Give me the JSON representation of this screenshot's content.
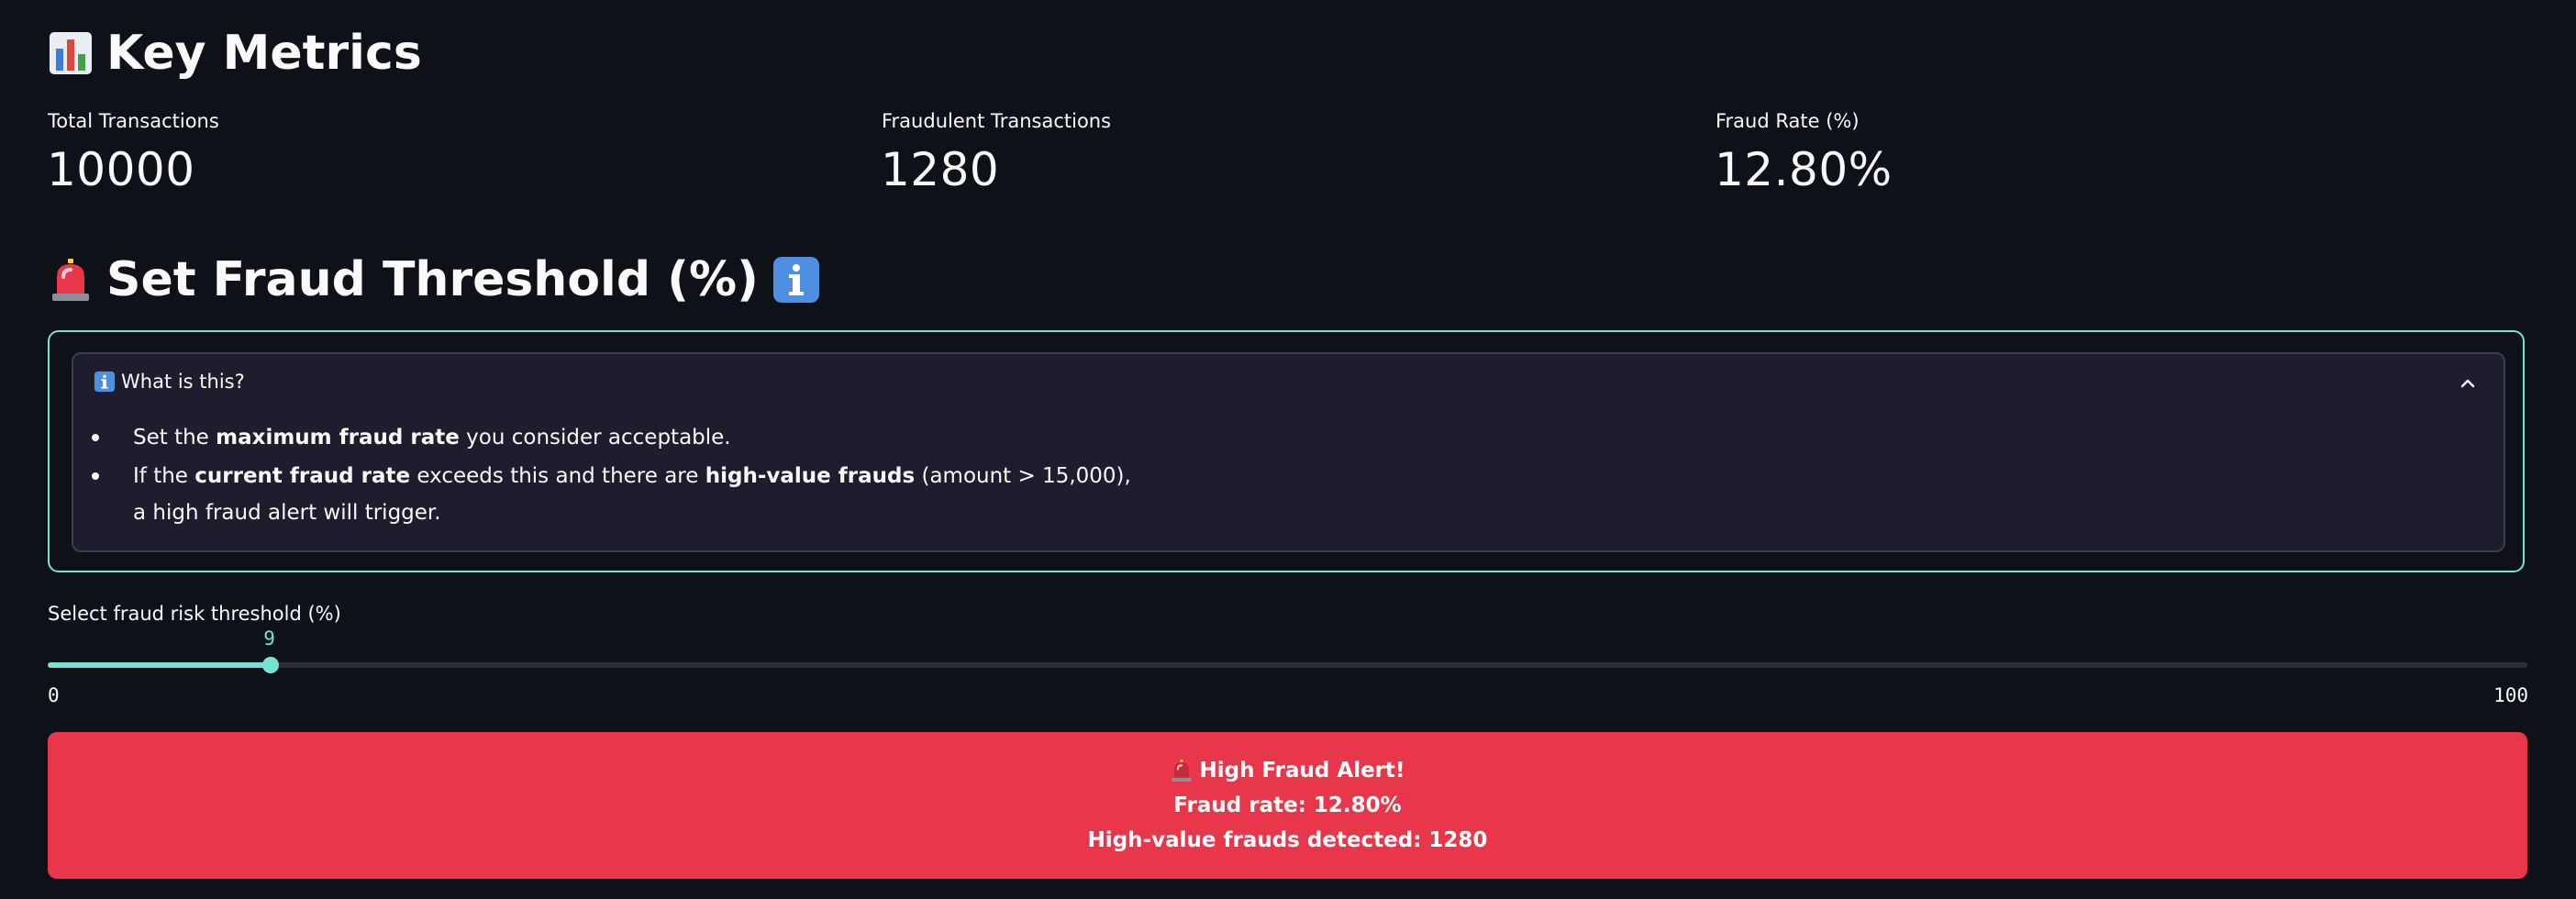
{
  "colors": {
    "background": "#0e1117",
    "accent": "#76e3d2",
    "alert_bg": "#e8364b",
    "expander_bg": "#1e1d2e"
  },
  "key_metrics": {
    "heading": "Key Metrics",
    "heading_icon": "bar-chart-icon",
    "metrics": [
      {
        "label": "Total Transactions",
        "value": "10000"
      },
      {
        "label": "Fraudulent Transactions",
        "value": "1280"
      },
      {
        "label": "Fraud Rate (%)",
        "value": "12.80%"
      }
    ]
  },
  "threshold": {
    "heading": "Set Fraud Threshold (%)",
    "heading_icon": "siren-icon",
    "trailing_icon": "info-icon",
    "expander": {
      "title": "What is this?",
      "title_icon": "info-icon",
      "expanded": true,
      "bullet1": {
        "t1": "Set the ",
        "b1": "maximum fraud rate",
        "t2": " you consider acceptable."
      },
      "bullet2": {
        "t1": "If the ",
        "b1": "current fraud rate",
        "t2": " exceeds this and there are ",
        "b2": "high-value frauds",
        "t3": " (amount > 15,000),",
        "line2": "a high fraud alert will trigger."
      }
    },
    "slider": {
      "label": "Select fraud risk threshold (%)",
      "value": 9,
      "min": 0,
      "max": 100
    }
  },
  "alert": {
    "icon": "siren-icon",
    "title": "High Fraud Alert!",
    "line2": "Fraud rate: 12.80%",
    "line3": "High-value frauds detected: 1280"
  }
}
